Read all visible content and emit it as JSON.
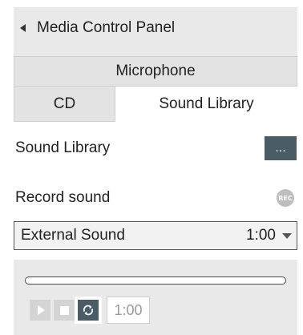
{
  "header": {
    "title": "Media Control Panel"
  },
  "tabs": {
    "microphone": "Microphone",
    "cd": "CD",
    "sound_library": "Sound Library",
    "active": "Sound Library"
  },
  "sound_library_row": {
    "label": "Sound Library",
    "browse_label": "..."
  },
  "record_row": {
    "label": "Record sound",
    "rec_label": "REC"
  },
  "sound_select": {
    "name": "External Sound",
    "duration": "1:00"
  },
  "player": {
    "time": "1:00",
    "progress": 0,
    "loop_active": true
  },
  "colors": {
    "accent": "#4a5d67",
    "panel_bg": "#e9e9e9",
    "tab_bg": "#e3e3e3",
    "disabled": "#d4d4d4",
    "rec_bg": "#bdbdbd"
  },
  "icons": {
    "collapse": "collapse-left-icon",
    "dropdown": "chevron-down-icon",
    "play": "play-icon",
    "stop": "stop-icon",
    "loop": "loop-icon"
  }
}
